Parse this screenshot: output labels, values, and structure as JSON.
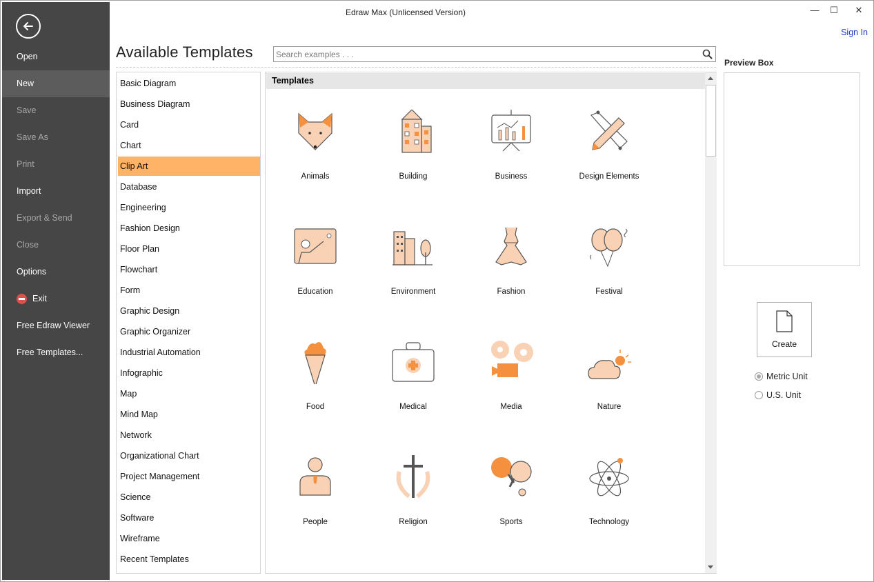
{
  "window": {
    "title": "Edraw Max (Unlicensed Version)",
    "minimize_glyph": "—",
    "maximize_glyph": "☐",
    "close_glyph": "✕",
    "sign_in": "Sign In"
  },
  "sidebar": {
    "items": [
      {
        "label": "Open",
        "state": "normal"
      },
      {
        "label": "New",
        "state": "active"
      },
      {
        "label": "Save",
        "state": "disabled"
      },
      {
        "label": "Save As",
        "state": "disabled"
      },
      {
        "label": "Print",
        "state": "disabled"
      },
      {
        "label": "Import",
        "state": "normal"
      },
      {
        "label": "Export & Send",
        "state": "disabled"
      },
      {
        "label": "Close",
        "state": "disabled"
      },
      {
        "label": "Options",
        "state": "normal"
      },
      {
        "label": "Exit",
        "state": "normal",
        "icon": "exit-icon"
      },
      {
        "label": "Free Edraw Viewer",
        "state": "normal"
      },
      {
        "label": "Free Templates...",
        "state": "normal"
      }
    ]
  },
  "header": {
    "title": "Available Templates",
    "search_placeholder": "Search examples . . ."
  },
  "categories": {
    "selected": "Clip Art",
    "items": [
      "Basic Diagram",
      "Business Diagram",
      "Card",
      "Chart",
      "Clip Art",
      "Database",
      "Engineering",
      "Fashion Design",
      "Floor Plan",
      "Flowchart",
      "Form",
      "Graphic Design",
      "Graphic Organizer",
      "Industrial Automation",
      "Infographic",
      "Map",
      "Mind Map",
      "Network",
      "Organizational Chart",
      "Project Management",
      "Science",
      "Software",
      "Wireframe",
      "Recent Templates"
    ]
  },
  "templates": {
    "header": "Templates",
    "items": [
      {
        "label": "Animals",
        "icon": "fox-icon"
      },
      {
        "label": "Building",
        "icon": "building-icon"
      },
      {
        "label": "Business",
        "icon": "presentation-board-icon"
      },
      {
        "label": "Design Elements",
        "icon": "pencil-ruler-icon"
      },
      {
        "label": "Education",
        "icon": "teacher-board-icon"
      },
      {
        "label": "Environment",
        "icon": "city-tree-icon"
      },
      {
        "label": "Fashion",
        "icon": "dress-icon"
      },
      {
        "label": "Festival",
        "icon": "balloons-icon"
      },
      {
        "label": "Food",
        "icon": "ice-cream-icon"
      },
      {
        "label": "Medical",
        "icon": "first-aid-kit-icon"
      },
      {
        "label": "Media",
        "icon": "film-camera-icon"
      },
      {
        "label": "Nature",
        "icon": "sun-cloud-icon"
      },
      {
        "label": "People",
        "icon": "person-icon"
      },
      {
        "label": "Religion",
        "icon": "cross-icon"
      },
      {
        "label": "Sports",
        "icon": "ping-pong-icon"
      },
      {
        "label": "Technology",
        "icon": "atom-icon"
      }
    ]
  },
  "preview": {
    "title": "Preview Box",
    "create_label": "Create",
    "units": [
      {
        "label": "Metric Unit",
        "checked": true
      },
      {
        "label": "U.S. Unit",
        "checked": false
      }
    ]
  },
  "colors": {
    "sidebar_bg": "#464646",
    "accent_orange": "#f5913e",
    "selection": "#ffb366",
    "icon_fill": "#f9d2b5",
    "link_blue": "#1b3cc6"
  }
}
